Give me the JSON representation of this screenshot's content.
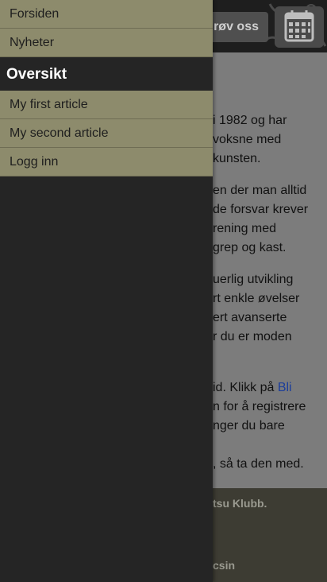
{
  "drawer": {
    "top_items": [
      {
        "label": "Forsiden"
      },
      {
        "label": "Nyheter"
      }
    ],
    "section_title": "Oversikt",
    "section_items": [
      {
        "label": "My first article"
      },
      {
        "label": "My second article"
      },
      {
        "label": "Logg inn"
      }
    ]
  },
  "page": {
    "header": {
      "try_button_label": "røv oss",
      "calendar_icon": "calendar-icon"
    },
    "paragraphs": [
      {
        "lines": [
          "i 1982 og har",
          "voksne med",
          "kunsten."
        ]
      },
      {
        "lines": [
          "en der man alltid",
          "de forsvar krever",
          "rening med",
          "grep og kast."
        ]
      },
      {
        "lines": [
          "uerlig utvikling",
          "rt enkle øvelser",
          "ert avanserte",
          "r du er moden"
        ]
      },
      {
        "lines": [
          "id. Klikk på ",
          "n for å registrere",
          "nger du bare"
        ],
        "link": "Bli"
      },
      {
        "lines": [
          ", så ta den med."
        ]
      }
    ],
    "footer": {
      "line1": "tsu Klubb.",
      "line2": "csin"
    }
  }
}
